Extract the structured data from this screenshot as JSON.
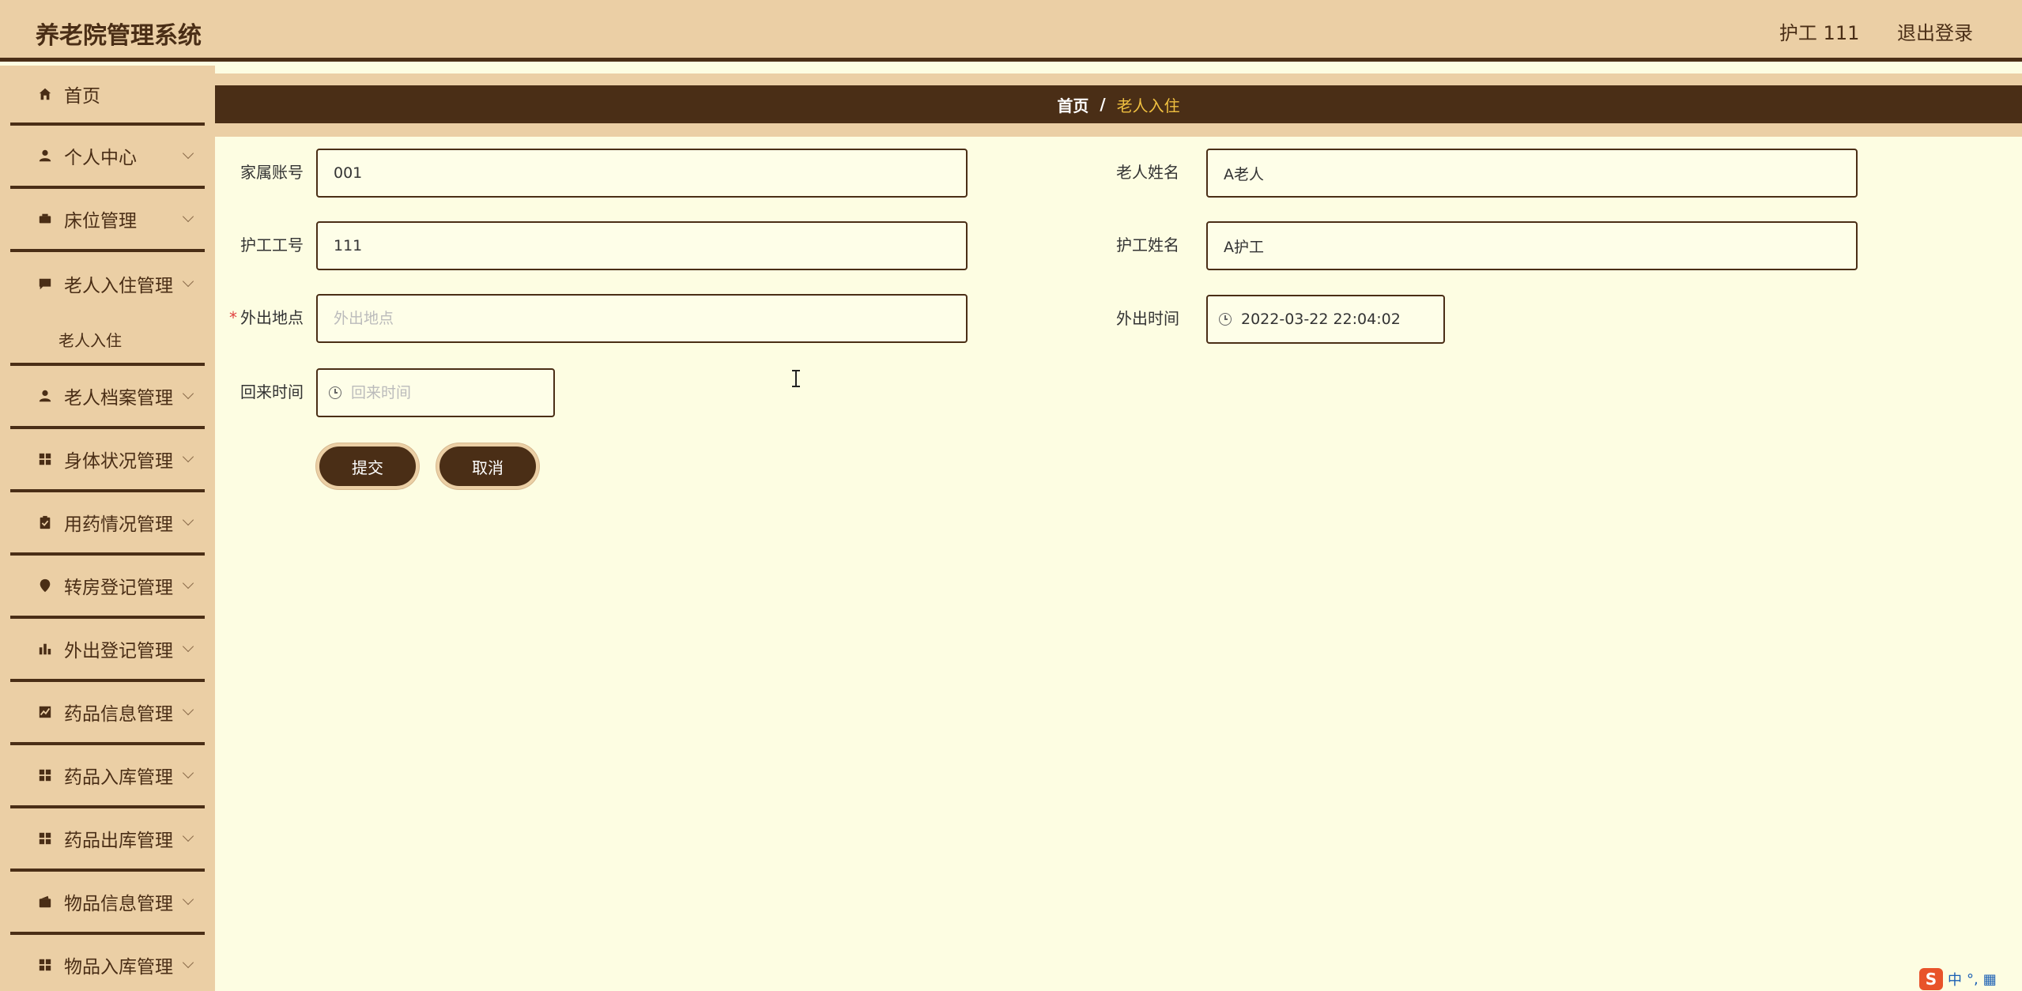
{
  "app": {
    "title": "养老院管理系统",
    "user_label": "护工 111",
    "logout_label": "退出登录"
  },
  "sidebar": {
    "items": [
      {
        "label": "首页",
        "icon": "home-icon",
        "expandable": false
      },
      {
        "label": "个人中心",
        "icon": "user-icon",
        "expandable": true
      },
      {
        "label": "床位管理",
        "icon": "bed-icon",
        "expandable": true
      },
      {
        "label": "老人入住管理",
        "icon": "chat-icon",
        "expandable": true
      },
      {
        "label": "老人档案管理",
        "icon": "user-icon",
        "expandable": true
      },
      {
        "label": "身体状况管理",
        "icon": "grid-icon",
        "expandable": true
      },
      {
        "label": "用药情况管理",
        "icon": "clipboard-icon",
        "expandable": true
      },
      {
        "label": "转房登记管理",
        "icon": "pin-icon",
        "expandable": true
      },
      {
        "label": "外出登记管理",
        "icon": "bar-chart-icon",
        "expandable": true
      },
      {
        "label": "药品信息管理",
        "icon": "line-chart-icon",
        "expandable": true
      },
      {
        "label": "药品入库管理",
        "icon": "grid-icon",
        "expandable": true
      },
      {
        "label": "药品出库管理",
        "icon": "grid-icon",
        "expandable": true
      },
      {
        "label": "物品信息管理",
        "icon": "wallet-icon",
        "expandable": true
      },
      {
        "label": "物品入库管理",
        "icon": "grid-icon",
        "expandable": true
      }
    ],
    "submenu_label": "老人入住"
  },
  "breadcrumb": {
    "home": "首页",
    "separator": "/",
    "current": "老人入住"
  },
  "form": {
    "family_account_label": "家属账号",
    "family_account_value": "001",
    "elder_name_label": "老人姓名",
    "elder_name_value": "A老人",
    "caregiver_id_label": "护工工号",
    "caregiver_id_value": "111",
    "caregiver_name_label": "护工姓名",
    "caregiver_name_value": "A护工",
    "out_place_label": "外出地点",
    "out_place_placeholder": "外出地点",
    "out_time_label": "外出时间",
    "out_time_value": "2022-03-22 22:04:02",
    "return_time_label": "回来时间",
    "return_time_placeholder": "回来时间",
    "required_mark": "*",
    "submit_label": "提交",
    "cancel_label": "取消"
  },
  "ime": {
    "logo": "S",
    "mode": "中"
  },
  "colors": {
    "primary": "#4a2e16",
    "header_bg": "#ebcfa5",
    "page_bg": "#fdfde2",
    "crumb_current": "#f0c040"
  }
}
